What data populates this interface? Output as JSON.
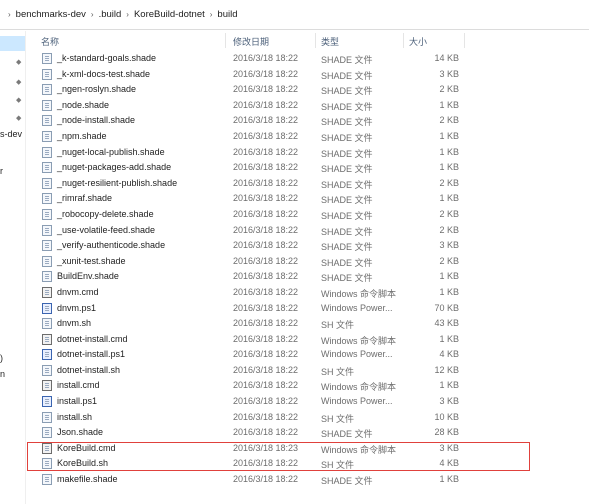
{
  "breadcrumb": {
    "segments": [
      "benchmarks-dev",
      ".build",
      "KoreBuild-dotnet",
      "build"
    ]
  },
  "nav": {
    "items": [
      "s-dev",
      "r",
      ")",
      "n"
    ]
  },
  "columns": {
    "name": "名称",
    "date": "修改日期",
    "type": "类型",
    "size": "大小"
  },
  "files": [
    {
      "name": "_k-standard-goals.shade",
      "date": "2016/3/18 18:22",
      "type": "SHADE 文件",
      "size": "14 KB",
      "icon": "file"
    },
    {
      "name": "_k-xml-docs-test.shade",
      "date": "2016/3/18 18:22",
      "type": "SHADE 文件",
      "size": "3 KB",
      "icon": "file"
    },
    {
      "name": "_ngen-roslyn.shade",
      "date": "2016/3/18 18:22",
      "type": "SHADE 文件",
      "size": "2 KB",
      "icon": "file"
    },
    {
      "name": "_node.shade",
      "date": "2016/3/18 18:22",
      "type": "SHADE 文件",
      "size": "1 KB",
      "icon": "file"
    },
    {
      "name": "_node-install.shade",
      "date": "2016/3/18 18:22",
      "type": "SHADE 文件",
      "size": "2 KB",
      "icon": "file"
    },
    {
      "name": "_npm.shade",
      "date": "2016/3/18 18:22",
      "type": "SHADE 文件",
      "size": "1 KB",
      "icon": "file"
    },
    {
      "name": "_nuget-local-publish.shade",
      "date": "2016/3/18 18:22",
      "type": "SHADE 文件",
      "size": "1 KB",
      "icon": "file"
    },
    {
      "name": "_nuget-packages-add.shade",
      "date": "2016/3/18 18:22",
      "type": "SHADE 文件",
      "size": "1 KB",
      "icon": "file"
    },
    {
      "name": "_nuget-resilient-publish.shade",
      "date": "2016/3/18 18:22",
      "type": "SHADE 文件",
      "size": "2 KB",
      "icon": "file"
    },
    {
      "name": "_rimraf.shade",
      "date": "2016/3/18 18:22",
      "type": "SHADE 文件",
      "size": "1 KB",
      "icon": "file"
    },
    {
      "name": "_robocopy-delete.shade",
      "date": "2016/3/18 18:22",
      "type": "SHADE 文件",
      "size": "2 KB",
      "icon": "file"
    },
    {
      "name": "_use-volatile-feed.shade",
      "date": "2016/3/18 18:22",
      "type": "SHADE 文件",
      "size": "2 KB",
      "icon": "file"
    },
    {
      "name": "_verify-authenticode.shade",
      "date": "2016/3/18 18:22",
      "type": "SHADE 文件",
      "size": "3 KB",
      "icon": "file"
    },
    {
      "name": "_xunit-test.shade",
      "date": "2016/3/18 18:22",
      "type": "SHADE 文件",
      "size": "2 KB",
      "icon": "file"
    },
    {
      "name": "BuildEnv.shade",
      "date": "2016/3/18 18:22",
      "type": "SHADE 文件",
      "size": "1 KB",
      "icon": "file"
    },
    {
      "name": "dnvm.cmd",
      "date": "2016/3/18 18:22",
      "type": "Windows 命令脚本",
      "size": "1 KB",
      "icon": "cmd"
    },
    {
      "name": "dnvm.ps1",
      "date": "2016/3/18 18:22",
      "type": "Windows Power...",
      "size": "70 KB",
      "icon": "ps"
    },
    {
      "name": "dnvm.sh",
      "date": "2016/3/18 18:22",
      "type": "SH 文件",
      "size": "43 KB",
      "icon": "file"
    },
    {
      "name": "dotnet-install.cmd",
      "date": "2016/3/18 18:22",
      "type": "Windows 命令脚本",
      "size": "1 KB",
      "icon": "cmd"
    },
    {
      "name": "dotnet-install.ps1",
      "date": "2016/3/18 18:22",
      "type": "Windows Power...",
      "size": "4 KB",
      "icon": "ps"
    },
    {
      "name": "dotnet-install.sh",
      "date": "2016/3/18 18:22",
      "type": "SH 文件",
      "size": "12 KB",
      "icon": "file"
    },
    {
      "name": "install.cmd",
      "date": "2016/3/18 18:22",
      "type": "Windows 命令脚本",
      "size": "1 KB",
      "icon": "cmd"
    },
    {
      "name": "install.ps1",
      "date": "2016/3/18 18:22",
      "type": "Windows Power...",
      "size": "3 KB",
      "icon": "ps"
    },
    {
      "name": "install.sh",
      "date": "2016/3/18 18:22",
      "type": "SH 文件",
      "size": "10 KB",
      "icon": "file"
    },
    {
      "name": "Json.shade",
      "date": "2016/3/18 18:22",
      "type": "SHADE 文件",
      "size": "28 KB",
      "icon": "file"
    },
    {
      "name": "KoreBuild.cmd",
      "date": "2016/3/18 18:23",
      "type": "Windows 命令脚本",
      "size": "3 KB",
      "icon": "cmd"
    },
    {
      "name": "KoreBuild.sh",
      "date": "2016/3/18 18:22",
      "type": "SH 文件",
      "size": "4 KB",
      "icon": "file"
    },
    {
      "name": "makefile.shade",
      "date": "2016/3/18 18:22",
      "type": "SHADE 文件",
      "size": "1 KB",
      "icon": "file"
    }
  ],
  "colors": {
    "highlight_border": "#e0413c",
    "selection": "#cce8ff",
    "header_text": "#4c607a"
  }
}
